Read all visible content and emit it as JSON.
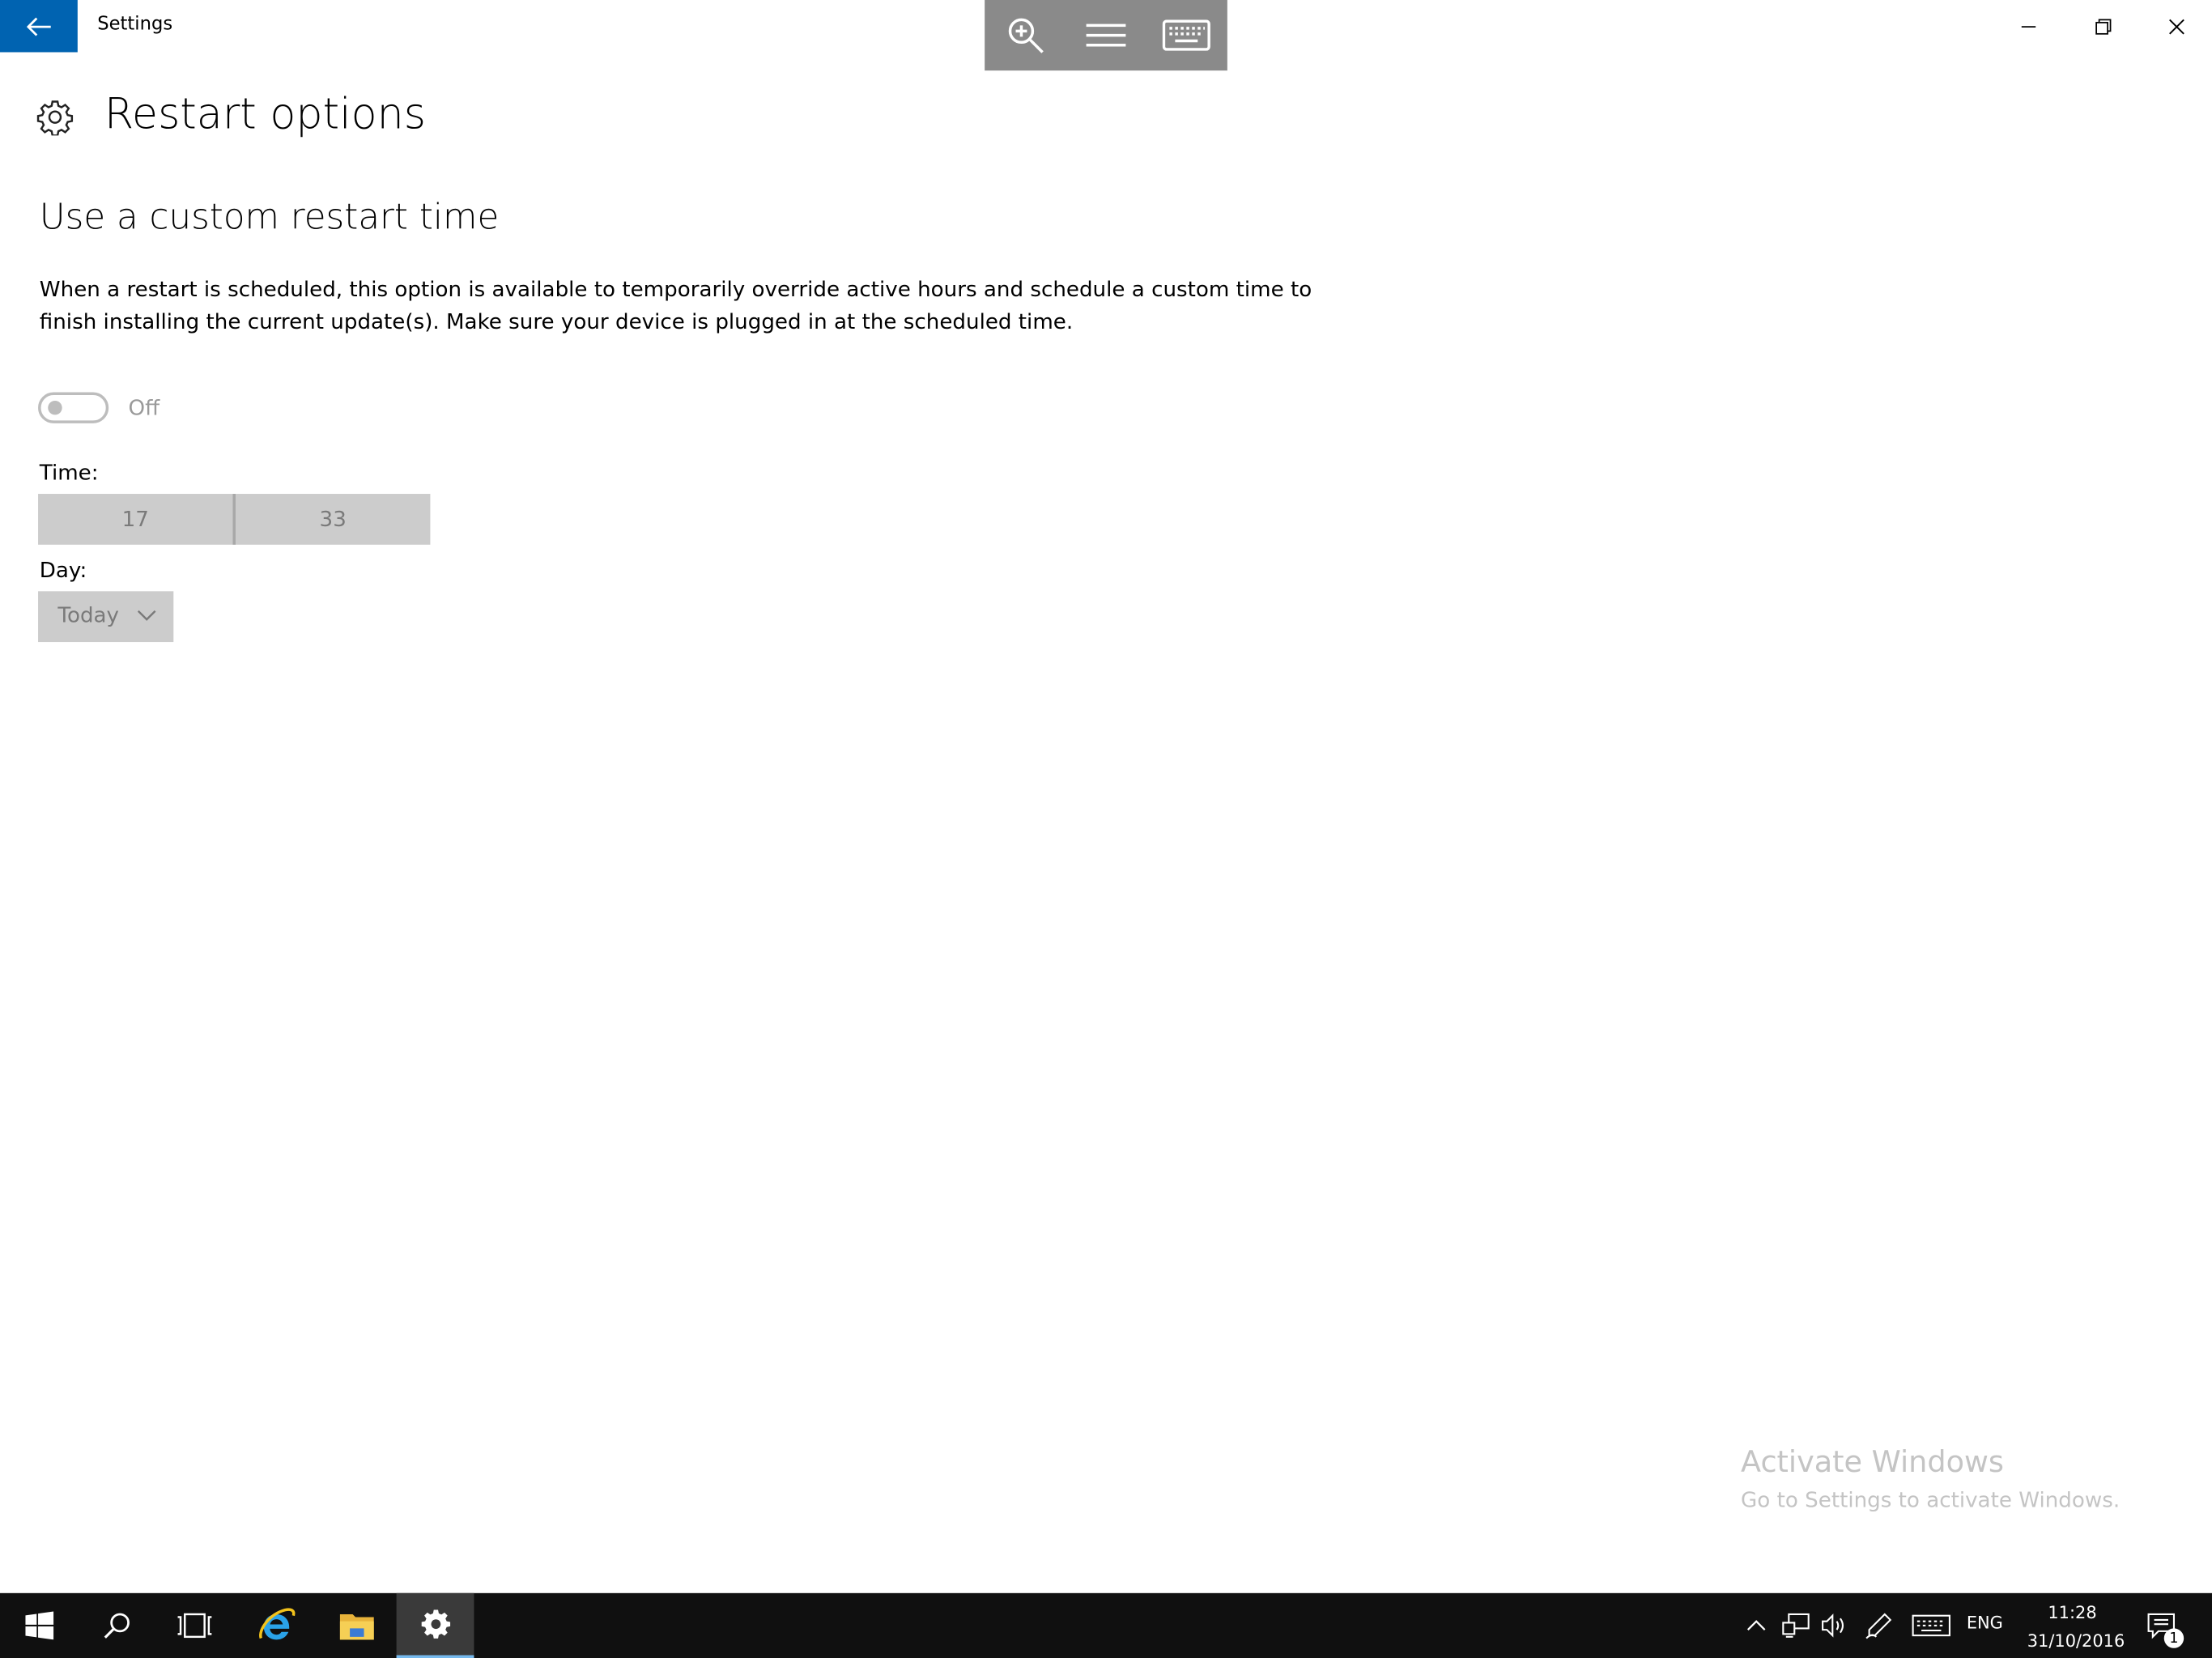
{
  "window": {
    "title": "Settings",
    "accent_color": "#0063b1"
  },
  "toolbar": {
    "icons": [
      "zoom-in-icon",
      "menu-icon",
      "keyboard-icon"
    ]
  },
  "page": {
    "title": "Restart options",
    "icon": "gear-icon"
  },
  "section": {
    "title": "Use a custom restart time",
    "description": "When a restart is scheduled, this option is available to temporarily override active hours and schedule a custom time to finish installing the current update(s). Make sure your device is plugged in at the scheduled time.",
    "toggle_state": "Off",
    "time_label": "Time:",
    "time_hour": "17",
    "time_minute": "33",
    "day_label": "Day:",
    "day_value": "Today"
  },
  "watermark": {
    "title": "Activate Windows",
    "subtitle": "Go to Settings to activate Windows."
  },
  "taskbar": {
    "apps": [
      "windows-start-icon",
      "search-icon",
      "task-view-icon",
      "internet-explorer-icon",
      "file-explorer-icon",
      "settings-gear-icon"
    ],
    "tray": {
      "language": "ENG",
      "time": "11:28",
      "date": "31/10/2016",
      "notification_count": "1"
    }
  }
}
